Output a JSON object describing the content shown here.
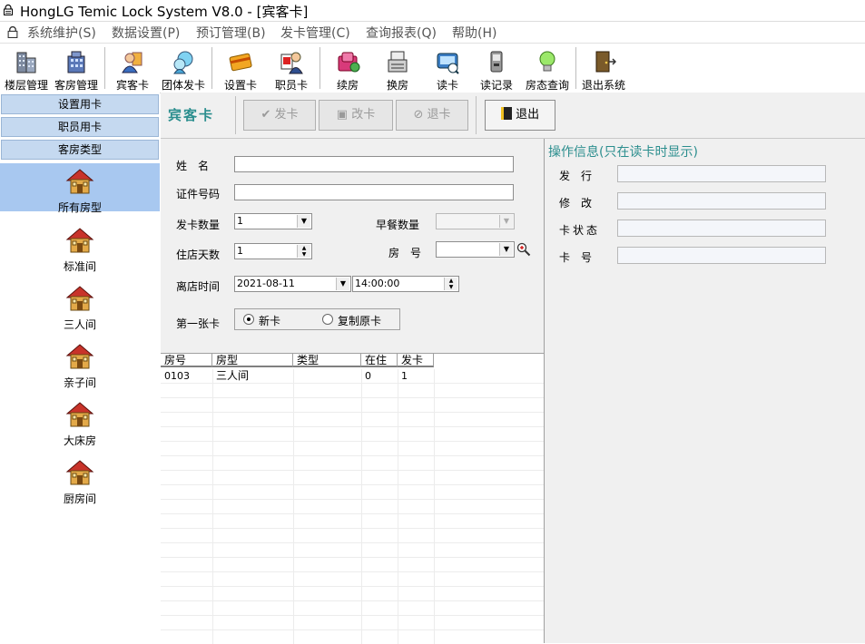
{
  "window": {
    "title": "HongLG Temic Lock System V8.0 - [宾客卡]"
  },
  "menu": [
    "系统维护(S)",
    "数据设置(P)",
    "预订管理(B)",
    "发卡管理(C)",
    "查询报表(Q)",
    "帮助(H)"
  ],
  "toolbar": [
    "楼层管理",
    "客房管理",
    "宾客卡",
    "团体发卡",
    "设置卡",
    "职员卡",
    "续房",
    "换房",
    "读卡",
    "读记录",
    "房态查询",
    "退出系统"
  ],
  "left": {
    "headers": [
      "设置用卡",
      "职员用卡",
      "客房类型"
    ],
    "room_types": [
      "所有房型",
      "标准间",
      "三人间",
      "亲子间",
      "大床房",
      "厨房间"
    ]
  },
  "card": {
    "title": "宾客卡",
    "buttons": {
      "issue": "发卡",
      "modify": "改卡",
      "refund": "退卡",
      "exit": "退出"
    }
  },
  "form": {
    "name_label": "姓　名",
    "id_label": "证件号码",
    "count_label": "发卡数量",
    "count_value": "1",
    "breakfast_label": "早餐数量",
    "days_label": "住店天数",
    "days_value": "1",
    "room_label": "房　号",
    "checkout_label": "离店时间",
    "checkout_date": "2021-08-11",
    "checkout_time": "14:00:00",
    "first_card_label": "第一张卡",
    "radio_new": "新卡",
    "radio_copy": "复制原卡"
  },
  "grid": {
    "headers": [
      "房号",
      "房型",
      "类型",
      "在住",
      "发卡"
    ],
    "rows": [
      {
        "room": "0103",
        "roomtype": "三人间",
        "type": "",
        "occupied": "0",
        "issued": "1"
      }
    ]
  },
  "info": {
    "title": "操作信息(只在读卡时显示)",
    "labels": [
      "发　行",
      "修　改",
      "卡状态",
      "卡　号"
    ]
  }
}
